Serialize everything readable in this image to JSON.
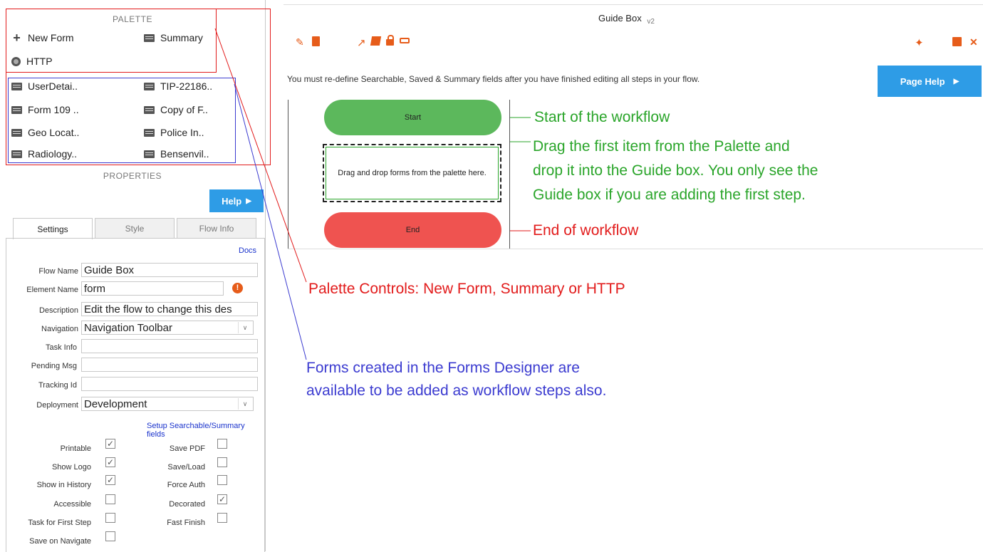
{
  "palette": {
    "heading": "PALETTE",
    "controls": [
      {
        "label": "New Form",
        "icon": "plus-icon"
      },
      {
        "label": "Summary",
        "icon": "summary-icon"
      },
      {
        "label": "HTTP",
        "icon": "globe-icon"
      }
    ],
    "forms": [
      "UserDetai..",
      "TIP-22186..",
      "Form 109 ..",
      "Copy of F..",
      "Geo Locat..",
      "Police In..",
      "Radiology..",
      "Bensenvil.."
    ]
  },
  "properties": {
    "heading": "PROPERTIES",
    "help_label": "Help",
    "tabs": [
      "Settings",
      "Style",
      "Flow Info"
    ],
    "docs_link": "Docs",
    "fields": {
      "flow_name": {
        "label": "Flow Name",
        "value": "Guide Box"
      },
      "element_name": {
        "label": "Element Name",
        "value": "form"
      },
      "description": {
        "label": "Description",
        "value": "Edit the flow to change this des"
      },
      "navigation": {
        "label": "Navigation",
        "value": "Navigation Toolbar"
      },
      "task_info": {
        "label": "Task Info",
        "value": ""
      },
      "pending_msg": {
        "label": "Pending Msg",
        "value": ""
      },
      "tracking_id": {
        "label": "Tracking Id",
        "value": ""
      },
      "deployment": {
        "label": "Deployment",
        "value": "Development"
      }
    },
    "setup_link": "Setup Searchable/Summary fields",
    "checkboxes_left": [
      {
        "label": "Printable",
        "checked": true
      },
      {
        "label": "Show Logo",
        "checked": true
      },
      {
        "label": "Show in History",
        "checked": true
      },
      {
        "label": "Accessible",
        "checked": false
      },
      {
        "label": "Task for First Step",
        "checked": false
      },
      {
        "label": "Save on Navigate",
        "checked": false
      }
    ],
    "checkboxes_right": [
      {
        "label": "Save PDF",
        "checked": false
      },
      {
        "label": "Save/Load",
        "checked": false
      },
      {
        "label": "Force Auth",
        "checked": false
      },
      {
        "label": "Decorated",
        "checked": true
      },
      {
        "label": "Fast Finish",
        "checked": false
      }
    ]
  },
  "canvas": {
    "title": "Guide Box",
    "version": "v2",
    "notice": "You must re-define Searchable, Saved & Summary fields after you have finished editing all steps in your flow.",
    "page_help_label": "Page Help",
    "start_label": "Start",
    "drop_label": "Drag and drop forms from the palette here.",
    "end_label": "End"
  },
  "annotations": {
    "start": "Start of the workflow",
    "guide_lines": [
      "Drag the first item from the Palette and",
      "drop it into the Guide box. You only see the",
      "Guide box if you are adding the first step."
    ],
    "end": "End of workflow",
    "palette_controls": "Palette Controls: New Form, Summary or HTTP",
    "forms_lines": [
      "Forms created in the Forms Designer are",
      "available to be added as workflow steps also."
    ]
  },
  "colors": {
    "start_green": "#5cb85c",
    "end_red": "#ef5350",
    "accent_blue": "#2e9ce6",
    "annot_green": "#2aa52a",
    "annot_red": "#e21b1b",
    "annot_blue": "#3b3bd0"
  },
  "icons": [
    "pencil-icon",
    "document-icon",
    "external-link-icon",
    "book-icon",
    "lock-icon",
    "print-icon",
    "magic-wand-icon",
    "save-icon",
    "close-icon",
    "info-icon",
    "play-icon"
  ]
}
